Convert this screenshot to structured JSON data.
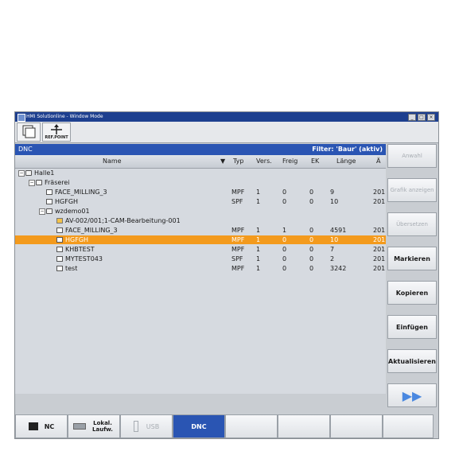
{
  "window": {
    "title": "HMI Solutionline - Window Mode"
  },
  "toolbar": {
    "refpoint_label": "REF.POINT"
  },
  "dnc": {
    "title": "DNC",
    "filter": "Filter: 'Baur' (aktiv)"
  },
  "columns": [
    "Name",
    "Typ",
    "Vers.",
    "Freig",
    "EK",
    "Länge",
    "Ä"
  ],
  "tree": [
    {
      "name": "Halle1",
      "kind": "folder",
      "indent": 0,
      "expander": "−",
      "typ": "",
      "vers": "",
      "freig": "",
      "ek": "",
      "laenge": "",
      "ae": ""
    },
    {
      "name": "Fräserei",
      "kind": "folder",
      "indent": 1,
      "expander": "−",
      "typ": "",
      "vers": "",
      "freig": "",
      "ek": "",
      "laenge": "",
      "ae": ""
    },
    {
      "name": "FACE_MILLING_3",
      "kind": "file",
      "indent": 2,
      "expander": "",
      "typ": "MPF",
      "vers": "1",
      "freig": "0",
      "ek": "0",
      "laenge": "9",
      "ae": "201"
    },
    {
      "name": "HGFGH",
      "kind": "file",
      "indent": 2,
      "expander": "",
      "typ": "SPF",
      "vers": "1",
      "freig": "0",
      "ek": "0",
      "laenge": "10",
      "ae": "201"
    },
    {
      "name": "wzdemo01",
      "kind": "folder",
      "indent": 2,
      "expander": "−",
      "typ": "",
      "vers": "",
      "freig": "",
      "ek": "",
      "laenge": "",
      "ae": ""
    },
    {
      "name": "AV-002/001;1-CAM-Bearbeitung-001",
      "kind": "prog",
      "indent": 3,
      "expander": "",
      "typ": "",
      "vers": "",
      "freig": "",
      "ek": "",
      "laenge": "",
      "ae": ""
    },
    {
      "name": "FACE_MILLING_3",
      "kind": "file",
      "indent": 3,
      "expander": "",
      "typ": "MPF",
      "vers": "1",
      "freig": "1",
      "ek": "0",
      "laenge": "4591",
      "ae": "201"
    },
    {
      "name": "HGFGH",
      "kind": "file",
      "indent": 3,
      "expander": "",
      "typ": "MPF",
      "vers": "1",
      "freig": "0",
      "ek": "0",
      "laenge": "10",
      "ae": "201",
      "selected": true
    },
    {
      "name": "KHBTEST",
      "kind": "file",
      "indent": 3,
      "expander": "",
      "typ": "MPF",
      "vers": "1",
      "freig": "0",
      "ek": "0",
      "laenge": "7",
      "ae": "201"
    },
    {
      "name": "MYTEST043",
      "kind": "file",
      "indent": 3,
      "expander": "",
      "typ": "SPF",
      "vers": "1",
      "freig": "0",
      "ek": "0",
      "laenge": "2",
      "ae": "201"
    },
    {
      "name": "test",
      "kind": "file",
      "indent": 3,
      "expander": "",
      "typ": "MPF",
      "vers": "1",
      "freig": "0",
      "ek": "0",
      "laenge": "3242",
      "ae": "201"
    }
  ],
  "sidebar": [
    {
      "label": "Anwahl",
      "enabled": false
    },
    {
      "label": "Grafik anzeigen",
      "enabled": false
    },
    {
      "label": "Übersetzen",
      "enabled": false
    },
    {
      "label": "Markieren",
      "enabled": true
    },
    {
      "label": "Kopieren",
      "enabled": true
    },
    {
      "label": "Einfügen",
      "enabled": true
    },
    {
      "label": "Aktualisieren",
      "enabled": true
    },
    {
      "label": "▶▶",
      "enabled": true
    }
  ],
  "bottom": [
    {
      "label": "NC",
      "state": "normal"
    },
    {
      "label": "Lokal. Laufw.",
      "state": "normal"
    },
    {
      "label": "USB",
      "state": "disabled"
    },
    {
      "label": "DNC",
      "state": "active"
    },
    {
      "label": "",
      "state": "normal"
    },
    {
      "label": "",
      "state": "normal"
    },
    {
      "label": "",
      "state": "normal"
    },
    {
      "label": "",
      "state": "normal"
    }
  ],
  "colors": {
    "accent": "#2a55b3",
    "selection": "#f39a1d"
  }
}
